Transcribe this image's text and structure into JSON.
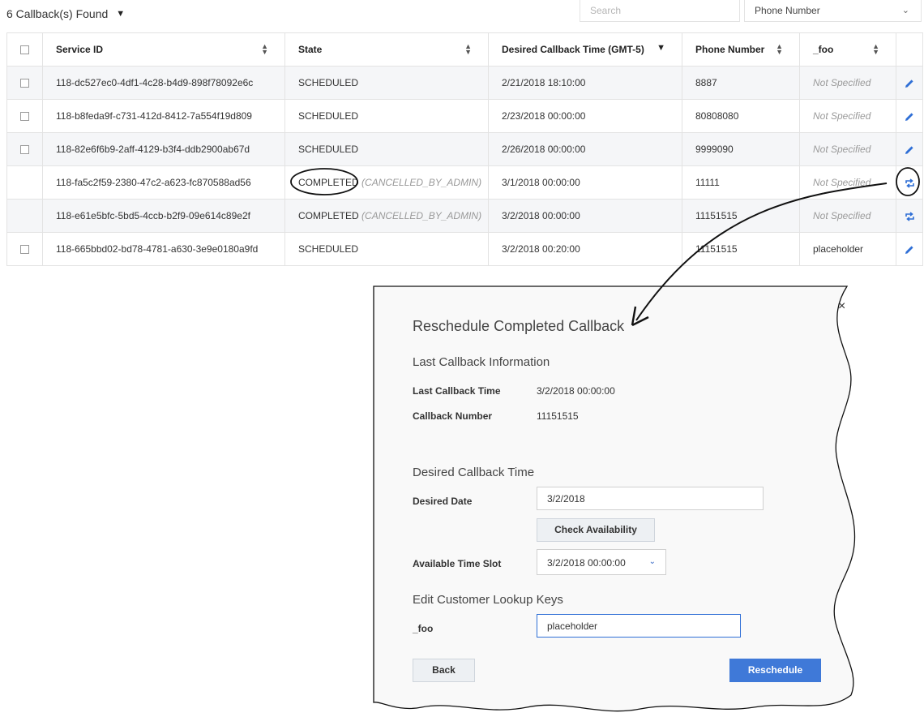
{
  "header": {
    "found_text": "6 Callback(s) Found",
    "search_placeholder": "Search",
    "filter_selected": "Phone Number"
  },
  "table": {
    "columns": [
      "Service ID",
      "State",
      "Desired Callback Time (GMT-5)",
      "Phone Number",
      "_foo"
    ],
    "rows": [
      {
        "id": "118-dc527ec0-4df1-4c28-b4d9-898f78092e6c",
        "state": "SCHEDULED",
        "sub": "",
        "time": "2/21/2018 18:10:00",
        "phone": "8887",
        "foo": "Not Specified"
      },
      {
        "id": "118-b8feda9f-c731-412d-8412-7a554f19d809",
        "state": "SCHEDULED",
        "sub": "",
        "time": "2/23/2018 00:00:00",
        "phone": "80808080",
        "foo": "Not Specified"
      },
      {
        "id": "118-82e6f6b9-2aff-4129-b3f4-ddb2900ab67d",
        "state": "SCHEDULED",
        "sub": "",
        "time": "2/26/2018 00:00:00",
        "phone": "9999090",
        "foo": "Not Specified"
      },
      {
        "id": "118-fa5c2f59-2380-47c2-a623-fc870588ad56",
        "state": "COMPLETED",
        "sub": "(CANCELLED_BY_ADMIN)",
        "time": "3/1/2018 00:00:00",
        "phone": "11111",
        "foo": "Not Specified"
      },
      {
        "id": "118-e61e5bfc-5bd5-4ccb-b2f9-09e614c89e2f",
        "state": "COMPLETED",
        "sub": "(CANCELLED_BY_ADMIN)",
        "time": "3/2/2018 00:00:00",
        "phone": "11151515",
        "foo": "Not Specified"
      },
      {
        "id": "118-665bbd02-bd78-4781-a630-3e9e0180a9fd",
        "state": "SCHEDULED",
        "sub": "",
        "time": "3/2/2018 00:20:00",
        "phone": "11151515",
        "foo": "placeholder"
      }
    ]
  },
  "modal": {
    "title": "Reschedule Completed Callback",
    "close_glyph": "×",
    "last_section": "Last Callback Information",
    "last_time_label": "Last Callback Time",
    "last_time_value": "3/2/2018 00:00:00",
    "callback_number_label": "Callback Number",
    "callback_number_value": "11151515",
    "desired_section": "Desired Callback Time",
    "desired_date_label": "Desired Date",
    "desired_date_value": "3/2/2018",
    "check_button": "Check Availability",
    "slot_label": "Available Time Slot",
    "slot_value": "3/2/2018 00:00:00",
    "edit_section": "Edit Customer Lookup Keys",
    "foo_label": "_foo",
    "foo_value": "placeholder",
    "back_button": "Back",
    "reschedule_button": "Reschedule"
  },
  "icons": {
    "edit": "pencil-icon",
    "reschedule": "repeat-icon",
    "accent": "#2f6fd6"
  }
}
